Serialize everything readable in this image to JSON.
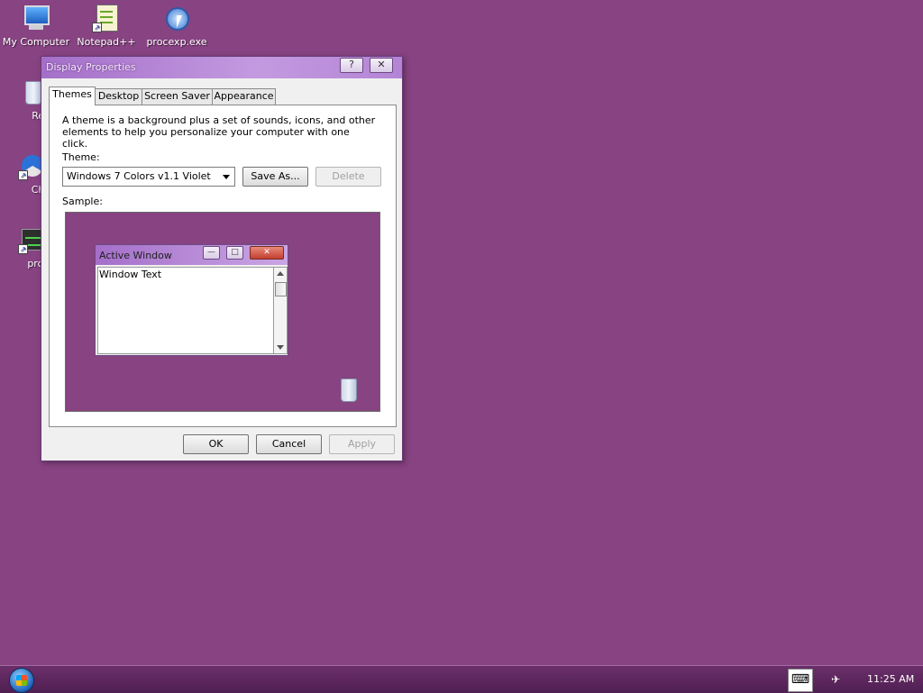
{
  "desktop": {
    "background_color": "#874382",
    "icons": [
      {
        "label": "My Computer",
        "icon": "computer-icon"
      },
      {
        "label": "Notepad++",
        "icon": "notepad-icon"
      },
      {
        "label": "procexp.exe",
        "icon": "process-explorer-icon"
      },
      {
        "label": "Recycl",
        "icon": "recycle-bin-icon"
      },
      {
        "label": "Chrom",
        "icon": "chrome-icon"
      },
      {
        "label": "processl",
        "icon": "process-lasso-icon"
      }
    ]
  },
  "dialog": {
    "title": "Display Properties",
    "help_label": "?",
    "close_label": "✕",
    "tabs": [
      {
        "label": "Themes",
        "active": true
      },
      {
        "label": "Desktop",
        "active": false
      },
      {
        "label": "Screen Saver",
        "active": false
      },
      {
        "label": "Appearance",
        "active": false
      }
    ],
    "description": "A theme is a background plus a set of sounds, icons, and other elements to help you personalize your computer with one click.",
    "theme_label": "Theme:",
    "theme_value": "Windows 7 Colors v1.1 Violet",
    "save_as_label": "Save As...",
    "delete_label": "Delete",
    "sample_label": "Sample:",
    "sample": {
      "window_title": "Active Window",
      "window_text": "Window Text",
      "close_glyph": "✕",
      "min_glyph": "—",
      "max_glyph": "□"
    },
    "ok_label": "OK",
    "cancel_label": "Cancel",
    "apply_label": "Apply"
  },
  "taskbar": {
    "keyboard_glyph": "⌨",
    "tray_glyph": "✈",
    "clock": "11:25 AM"
  }
}
